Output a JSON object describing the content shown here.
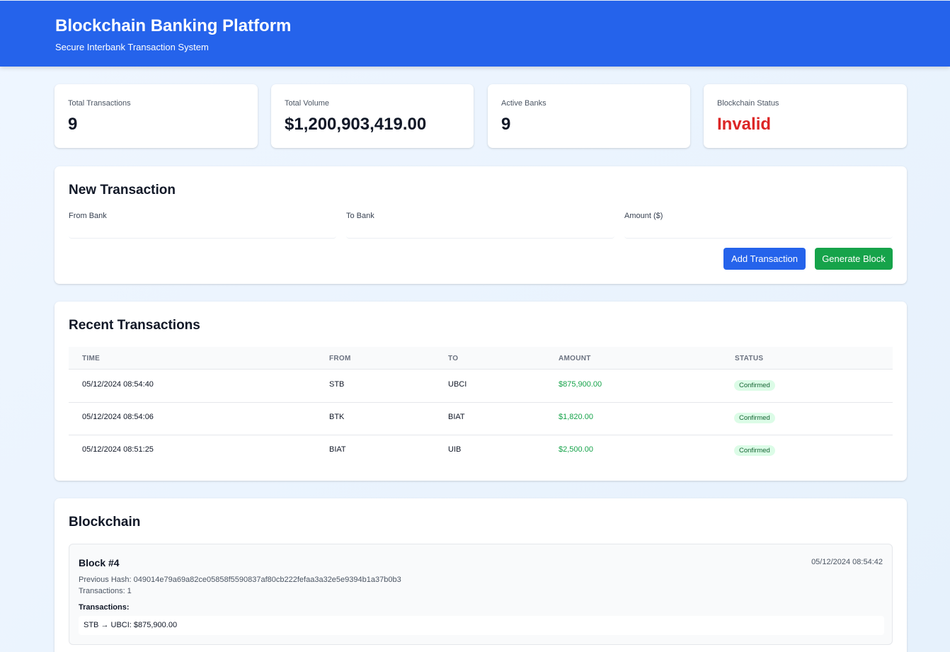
{
  "header": {
    "title": "Blockchain Banking Platform",
    "subtitle": "Secure Interbank Transaction System"
  },
  "stats": [
    {
      "label": "Total Transactions",
      "value": "9"
    },
    {
      "label": "Total Volume",
      "value": "$1,200,903,419.00"
    },
    {
      "label": "Active Banks",
      "value": "9"
    },
    {
      "label": "Blockchain Status",
      "value": "Invalid",
      "color": "#dc2626"
    }
  ],
  "new_transaction": {
    "title": "New Transaction",
    "from_label": "From Bank",
    "to_label": "To Bank",
    "amount_label": "Amount ($)",
    "from_value": "",
    "to_value": "",
    "amount_value": "",
    "add_button": "Add Transaction",
    "generate_button": "Generate Block"
  },
  "recent": {
    "title": "Recent Transactions",
    "columns": [
      "TIME",
      "FROM",
      "TO",
      "AMOUNT",
      "STATUS"
    ],
    "rows": [
      {
        "time": "05/12/2024 08:54:40",
        "from": "STB",
        "to": "UBCI",
        "amount": "$875,900.00",
        "status": "Confirmed"
      },
      {
        "time": "05/12/2024 08:54:06",
        "from": "BTK",
        "to": "BIAT",
        "amount": "$1,820.00",
        "status": "Confirmed"
      },
      {
        "time": "05/12/2024 08:51:25",
        "from": "BIAT",
        "to": "UIB",
        "amount": "$2,500.00",
        "status": "Confirmed"
      }
    ]
  },
  "blockchain": {
    "title": "Blockchain",
    "blocks": [
      {
        "title": "Block #4",
        "timestamp": "05/12/2024 08:54:42",
        "previous_hash": "Previous Hash: 049014e79a69a82ce05858f5590837af80cb222fefaa3a32e5e9394b1a37b0b3",
        "tx_count": "Transactions: 1",
        "tx_label": "Transactions:",
        "transactions": [
          "STB → UBCI: $875,900.00"
        ]
      }
    ]
  },
  "colors": {
    "primary": "#2563eb",
    "success": "#16a34a",
    "danger": "#dc2626"
  }
}
